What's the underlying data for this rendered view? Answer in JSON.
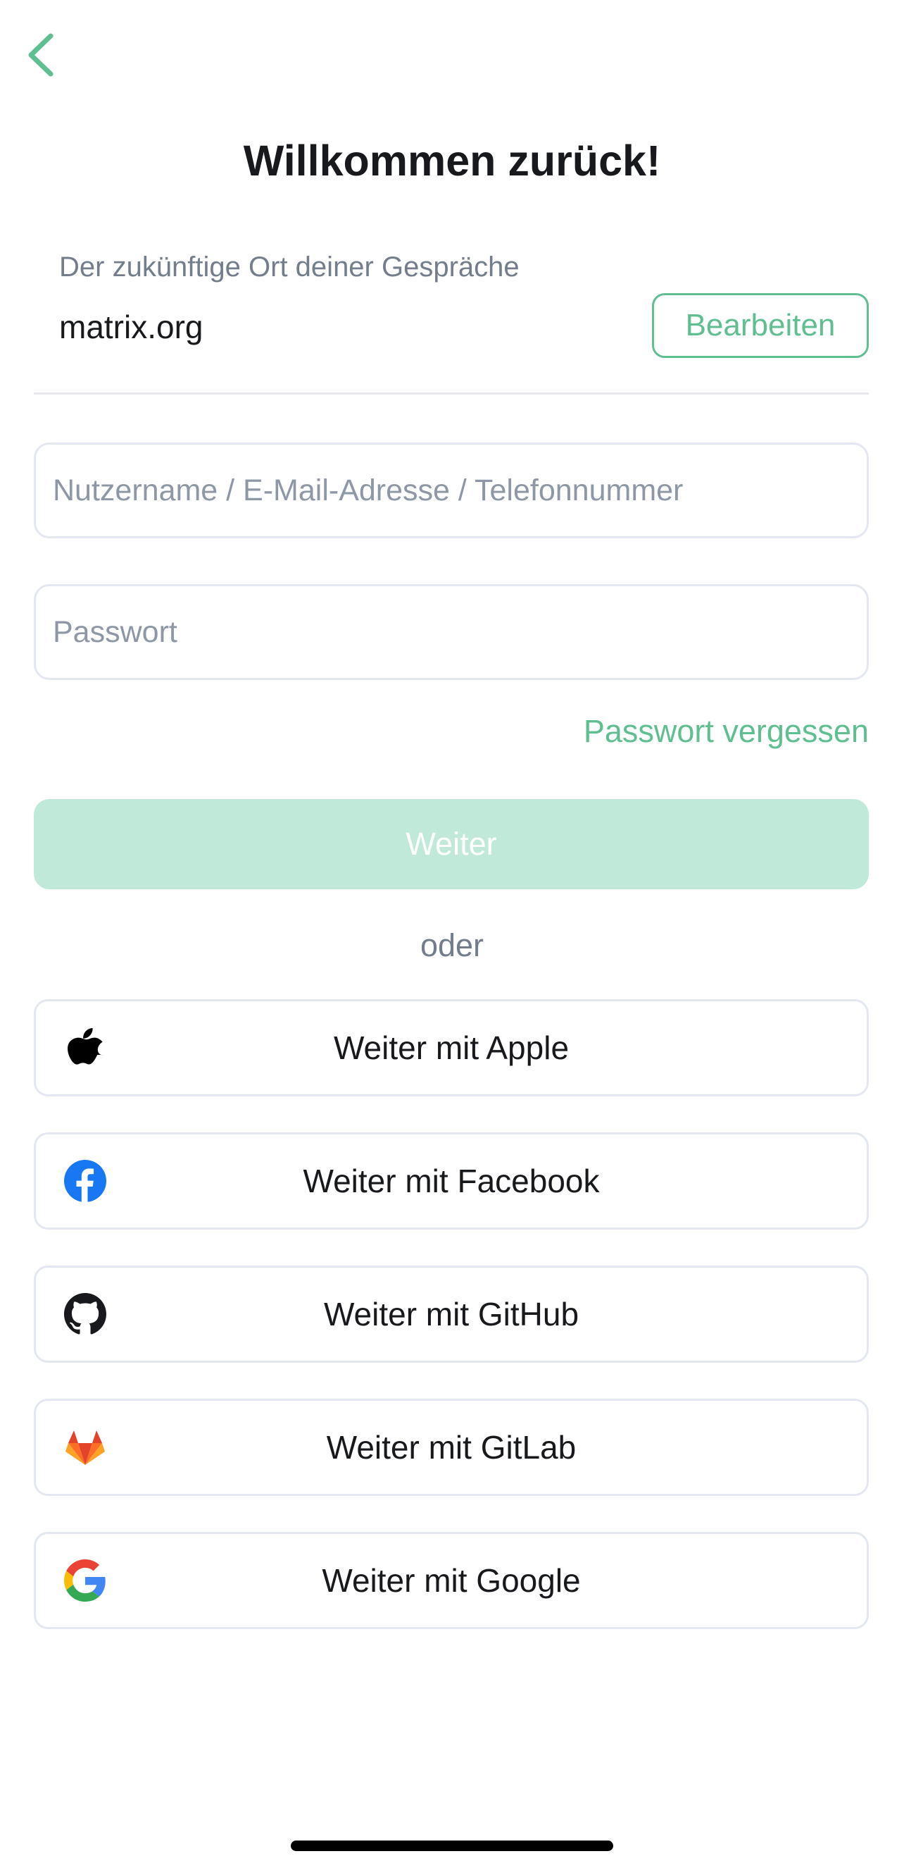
{
  "header": {
    "back_icon": "chevron-left-icon",
    "title": "Willkommen zurück!"
  },
  "server": {
    "caption": "Der zukünftige Ort deiner Gespräche",
    "name": "matrix.org",
    "edit_label": "Bearbeiten"
  },
  "form": {
    "username_placeholder": "Nutzername / E-Mail-Adresse / Telefonnummer",
    "username_value": "",
    "password_placeholder": "Passwort",
    "password_value": "",
    "forgot_password_label": "Passwort vergessen",
    "continue_label": "Weiter"
  },
  "separator_label": "oder",
  "sso": [
    {
      "label": "Weiter mit Apple",
      "icon": "apple-icon"
    },
    {
      "label": "Weiter mit Facebook",
      "icon": "facebook-icon"
    },
    {
      "label": "Weiter mit GitHub",
      "icon": "github-icon"
    },
    {
      "label": "Weiter mit GitLab",
      "icon": "gitlab-icon"
    },
    {
      "label": "Weiter mit Google",
      "icon": "google-icon"
    }
  ],
  "colors": {
    "accent": "#5fbf91",
    "accent_disabled": "#c1e9da",
    "text_primary": "#17191c",
    "text_secondary": "#737d8c",
    "placeholder": "#8d97a5",
    "border": "#e3e8f0",
    "facebook": "#1877f2"
  }
}
